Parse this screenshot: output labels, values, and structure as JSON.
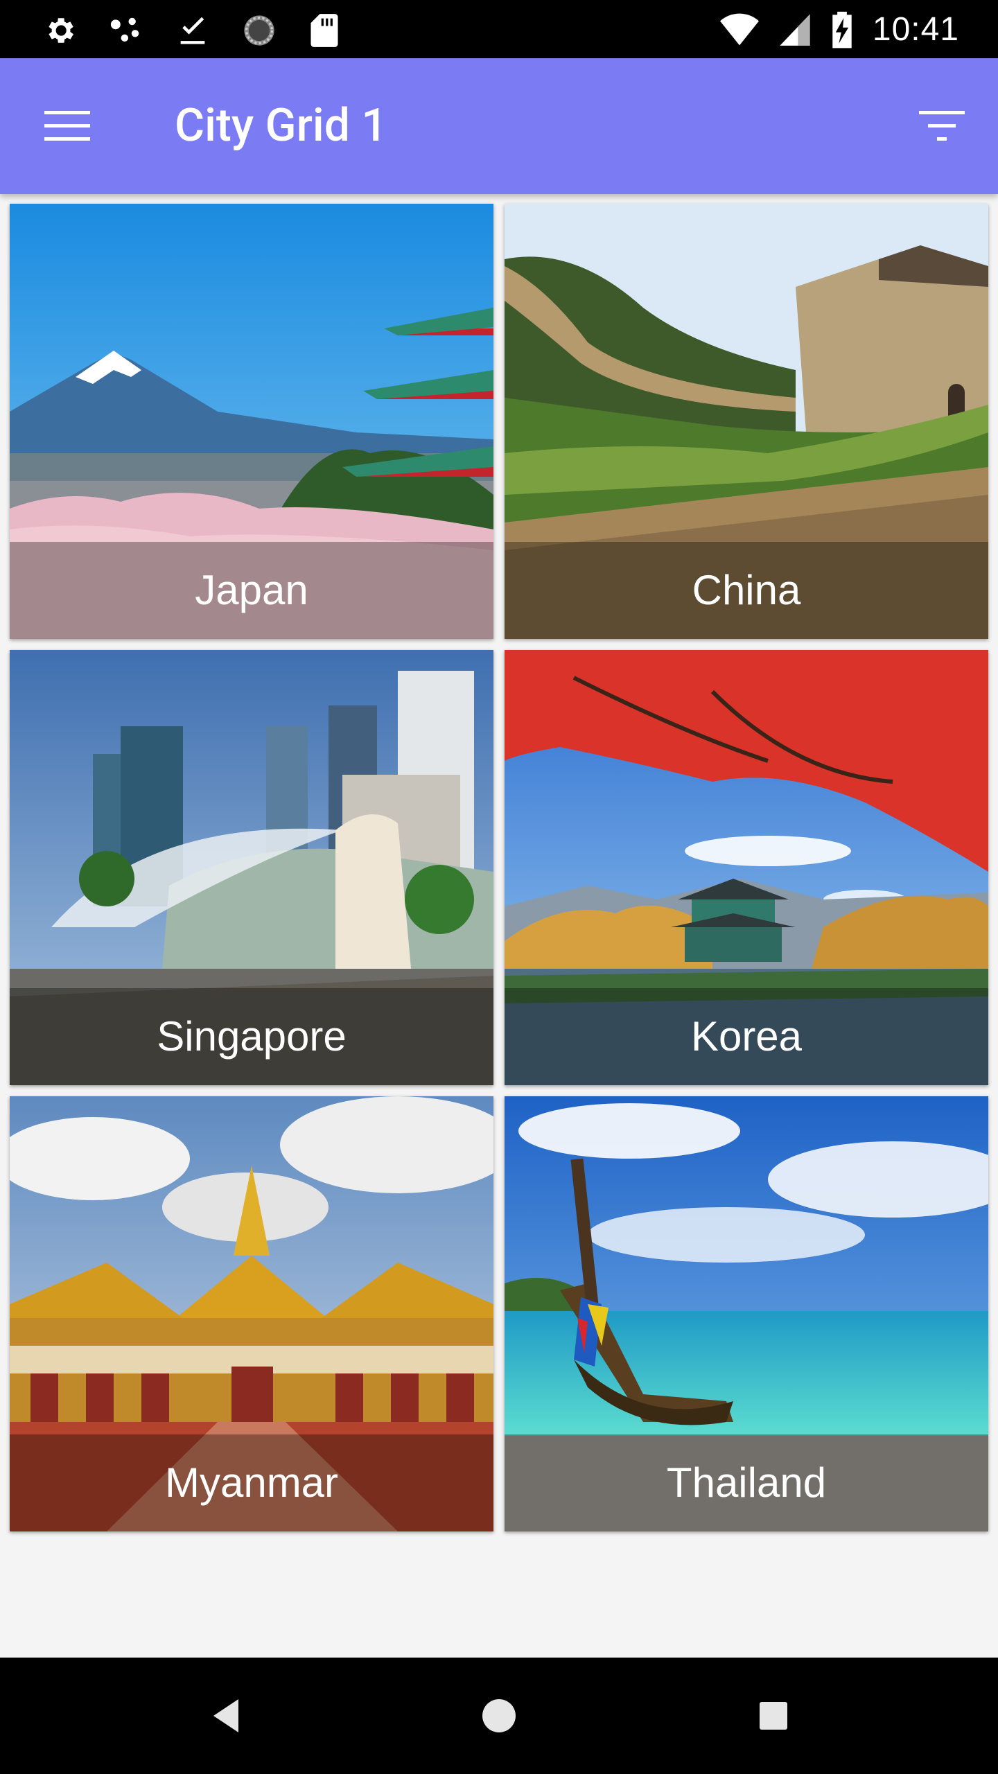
{
  "status_bar": {
    "time": "10:41",
    "left_icons": [
      "settings-icon",
      "network-dots-icon",
      "download-done-icon",
      "sync-circle-icon",
      "sd-card-icon"
    ],
    "right_icons": [
      "wifi-icon",
      "signal-icon",
      "battery-charging-icon"
    ]
  },
  "app_bar": {
    "title": "City Grid 1",
    "menu_icon": "menu-icon",
    "filter_icon": "filter-icon",
    "color": "#7b7cf3"
  },
  "cities": [
    {
      "name": "Japan"
    },
    {
      "name": "China"
    },
    {
      "name": "Singapore"
    },
    {
      "name": "Korea"
    },
    {
      "name": "Myanmar"
    },
    {
      "name": "Thailand"
    }
  ],
  "nav_bar": {
    "back": "back-icon",
    "home": "home-icon",
    "recents": "recents-icon"
  }
}
